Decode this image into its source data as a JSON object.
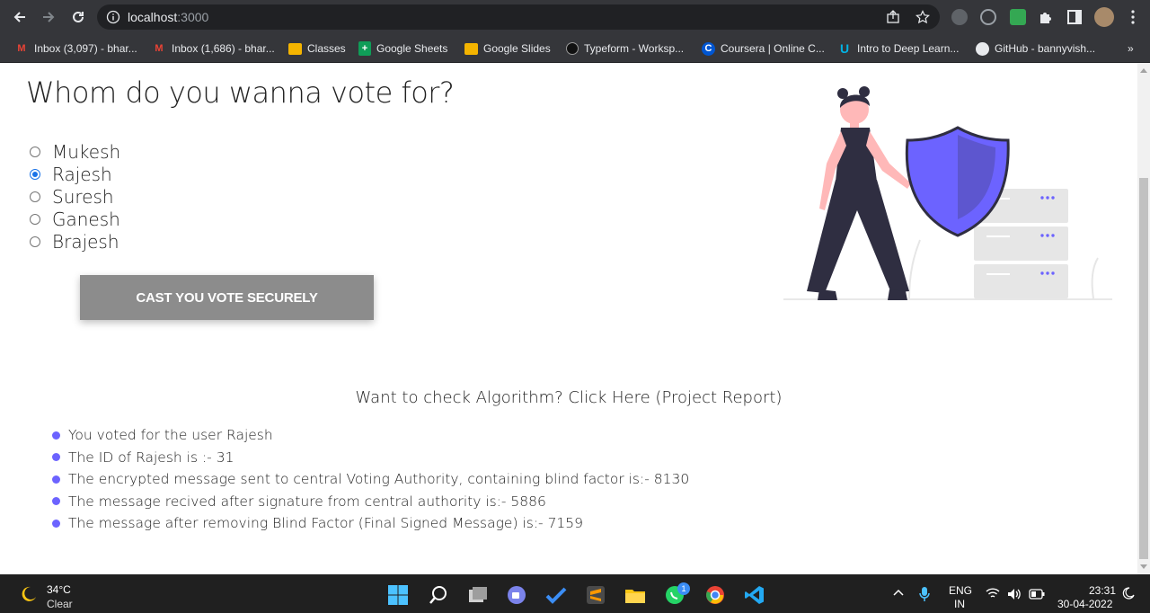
{
  "browser": {
    "url_host": "localhost",
    "url_port": ":3000",
    "bookmarks": [
      {
        "label": "Inbox (3,097) - bhar...",
        "icon": "gmail-icon"
      },
      {
        "label": "Inbox (1,686) - bhar...",
        "icon": "gmail-icon"
      },
      {
        "label": "Classes",
        "icon": "classroom-icon"
      },
      {
        "label": "Google Sheets",
        "icon": "sheets-icon"
      },
      {
        "label": "Google Slides",
        "icon": "slides-icon"
      },
      {
        "label": "Typeform - Worksp...",
        "icon": "typeform-icon"
      },
      {
        "label": "Coursera | Online C...",
        "icon": "coursera-icon"
      },
      {
        "label": "Intro to Deep Learn...",
        "icon": "udacity-icon"
      },
      {
        "label": "GitHub - bannyvish...",
        "icon": "github-icon"
      }
    ],
    "more_bookmarks": "»"
  },
  "page": {
    "title": "Whom do you wanna vote for?",
    "candidates": [
      {
        "name": "Mukesh",
        "checked": false
      },
      {
        "name": "Rajesh",
        "checked": true
      },
      {
        "name": "Suresh",
        "checked": false
      },
      {
        "name": "Ganesh",
        "checked": false
      },
      {
        "name": "Brajesh",
        "checked": false
      }
    ],
    "cast_button": "CAST YOU VOTE SECURELY",
    "algo_link": "Want to check Algorithm? Click Here (Project Report)",
    "results": [
      "You voted for the user Rajesh",
      "The ID of Rajesh is :- 31",
      "The encrypted message sent to central Voting Authority, containing blind factor is:- 8130",
      "The message recived after signature from central authority is:- 5886",
      "The message after removing Blind Factor (Final Signed Message) is:- 7159"
    ],
    "accent_color": "#6c63ff"
  },
  "taskbar": {
    "weather_temp": "34°C",
    "weather_desc": "Clear",
    "language": "ENG",
    "region": "IN",
    "time": "23:31",
    "date": "30-04-2022",
    "whatsapp_badge": "1"
  }
}
